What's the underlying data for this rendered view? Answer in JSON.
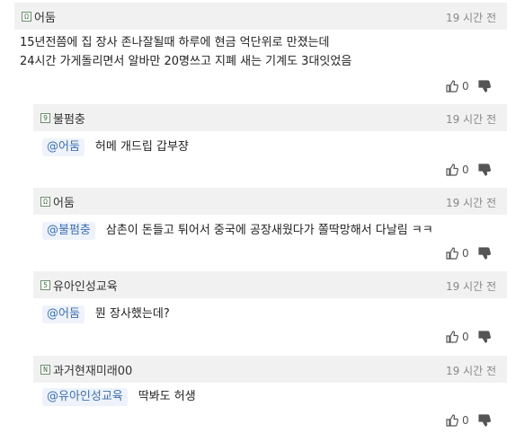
{
  "comments": [
    {
      "id": "c1",
      "nick": "어둠",
      "level": "Ω",
      "time": "19 시간 전",
      "mention": "",
      "lines": [
        "15년전쯤에 집 장사 존나잘될때 하루에 현금 억단위로 만졌는데",
        "24시간 가게돌리면서 알바만 20명쓰고 지폐 새는 기계도 3대잇었음"
      ],
      "likes": "0"
    },
    {
      "id": "c2",
      "nick": "불펌충",
      "level": "9",
      "time": "19 시간 전",
      "mention": "@어둠",
      "text": "허메 개드립 갑부쟝",
      "likes": "0"
    },
    {
      "id": "c3",
      "nick": "어둠",
      "level": "Ω",
      "time": "19 시간 전",
      "mention": "@불펌충",
      "text": "삼촌이 돈들고 튀어서 중국에 공장새웠다가 쫄딱망해서 다날림 ㅋㅋ",
      "likes": "0"
    },
    {
      "id": "c4",
      "nick": "유아인성교육",
      "level": "5",
      "time": "19 시간 전",
      "mention": "@어둠",
      "text": "뭔 장사했는데?",
      "likes": "0"
    },
    {
      "id": "c5",
      "nick": "과거현재미래00",
      "level": "N",
      "time": "19 시간 전",
      "mention": "@유아인성교육",
      "text": "딱봐도 허생",
      "likes": "0"
    }
  ],
  "icons": {
    "like": "thumbs-up-icon",
    "dislike": "thumbs-down-icon"
  }
}
